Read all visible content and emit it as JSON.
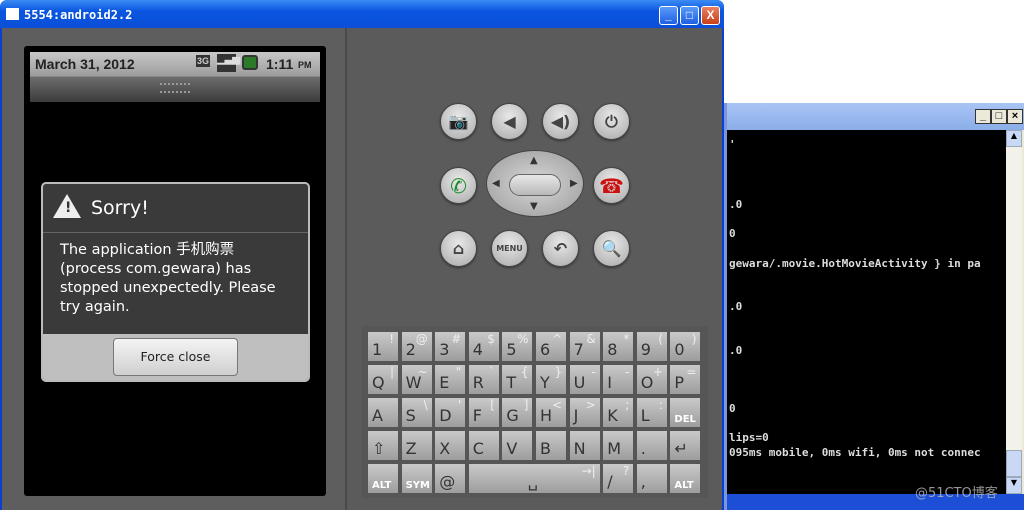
{
  "emulator": {
    "title": "5554:android2.2",
    "status": {
      "date": "March 31, 2012",
      "time": "1:11",
      "ampm": "PM",
      "network": "3G"
    },
    "dialog": {
      "title": "Sorry!",
      "message": "The application 手机购票 (process com.gewara) has stopped unexpectedly. Please try again.",
      "button": "Force close"
    },
    "controls": {
      "menu_label": "MENU"
    },
    "keyboard": {
      "rows": [
        [
          [
            "1",
            "!"
          ],
          [
            "2",
            "@"
          ],
          [
            "3",
            "#"
          ],
          [
            "4",
            "$"
          ],
          [
            "5",
            "%"
          ],
          [
            "6",
            "^"
          ],
          [
            "7",
            "&"
          ],
          [
            "8",
            "*"
          ],
          [
            "9",
            "("
          ],
          [
            "0",
            ")"
          ]
        ],
        [
          [
            "Q",
            "|"
          ],
          [
            "W",
            "~"
          ],
          [
            "E",
            "\""
          ],
          [
            "R",
            "`"
          ],
          [
            "T",
            "{"
          ],
          [
            "Y",
            "}"
          ],
          [
            "U",
            "-"
          ],
          [
            "I",
            "-"
          ],
          [
            "O",
            "+"
          ],
          [
            "P",
            "="
          ]
        ],
        [
          [
            "A",
            ""
          ],
          [
            "S",
            "\\"
          ],
          [
            "D",
            "'"
          ],
          [
            "F",
            "["
          ],
          [
            "G",
            "]"
          ],
          [
            "H",
            "<"
          ],
          [
            "J",
            ">"
          ],
          [
            "K",
            ";"
          ],
          [
            "L",
            ":"
          ],
          [
            "DEL",
            ""
          ]
        ],
        [
          [
            "⇧",
            ""
          ],
          [
            "Z",
            ""
          ],
          [
            "X",
            ""
          ],
          [
            "C",
            ""
          ],
          [
            "V",
            ""
          ],
          [
            "B",
            ""
          ],
          [
            "N",
            ""
          ],
          [
            "M",
            ""
          ],
          [
            ".",
            ""
          ],
          [
            "↵",
            ""
          ]
        ],
        [
          [
            "ALT",
            ""
          ],
          [
            "SYM",
            ""
          ],
          [
            "@",
            ""
          ],
          [
            "␣",
            "→|"
          ],
          [
            "/",
            "?"
          ],
          [
            ",",
            ""
          ],
          [
            "ALT",
            ""
          ]
        ]
      ]
    }
  },
  "console": {
    "lines": [
      "'",
      ".0",
      "0",
      "gewara/.movie.HotMovieActivity } in pa",
      ".0",
      ".0",
      "0",
      "lips=0",
      "095ms mobile, 0ms wifi, 0ms not connec"
    ]
  },
  "watermark": "@51CTO博客",
  "colors": {
    "titlebar": "#0a55e0",
    "call_green": "#1a8a2a",
    "end_red": "#cc1111"
  }
}
